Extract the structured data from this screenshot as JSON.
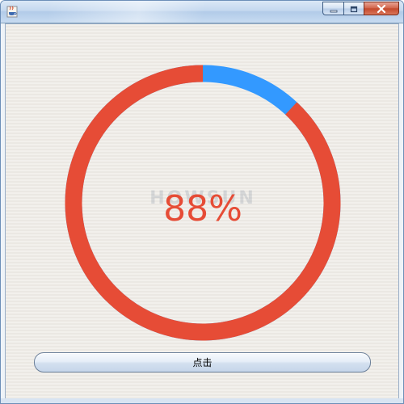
{
  "window": {
    "title": "",
    "icon": "java-cup-icon",
    "controls": [
      "minimize-icon",
      "maximize-icon",
      "close-icon"
    ]
  },
  "progress": {
    "value": 88,
    "label": "88%",
    "watermark": "HOWSUN",
    "colors": {
      "progress": "#e64c36",
      "remaining": "#3399ff",
      "text": "#e64c36"
    }
  },
  "button": {
    "label": "点击"
  }
}
